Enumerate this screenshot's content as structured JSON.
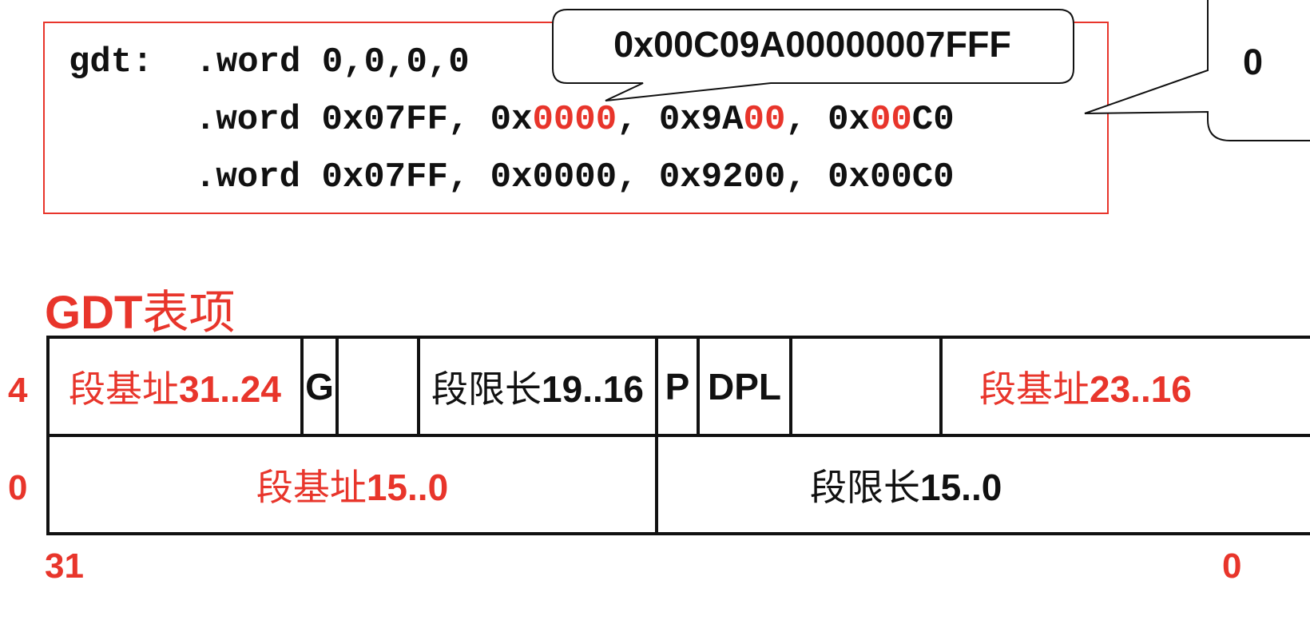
{
  "code": {
    "line1": {
      "label": "gdt:",
      "directive": ".word",
      "values": "0,0,0,0"
    },
    "line2": {
      "directive": ".word",
      "v1": "0x07FF, ",
      "v2_prefix": "0x",
      "v2_red": "0000",
      "sep2": ", ",
      "v3_prefix": "0x9A",
      "v3_red": "00",
      "sep3": ", ",
      "v4_prefix": "0x",
      "v4_red": "00",
      "v4_suffix": "C0"
    },
    "line3": {
      "directive": ".word",
      "values": "0x07FF, 0x0000, 0x9200, 0x00C0"
    }
  },
  "callouts": {
    "main": "0x00C09A00000007FFF",
    "partial": "0"
  },
  "section_title": {
    "latin": "GDT",
    "cjk": "表项"
  },
  "row_labels": {
    "top": "4",
    "bottom": "0"
  },
  "bit_labels": {
    "left": "31",
    "right": "0"
  },
  "table": {
    "row1": [
      {
        "cjk": "段基址",
        "num": "31..24",
        "red": true
      },
      {
        "cjk": "",
        "num": "G",
        "red": false
      },
      {
        "cjk": "",
        "num": "",
        "red": false
      },
      {
        "cjk": "段限长",
        "num": "19..16",
        "red": false
      },
      {
        "cjk": "",
        "num": "P",
        "red": false
      },
      {
        "cjk": "",
        "num": "DPL",
        "red": false
      },
      {
        "cjk": "",
        "num": "",
        "red": false
      },
      {
        "cjk": "段基址",
        "num": "23..16",
        "red": true
      }
    ],
    "row2": [
      {
        "cjk": "段基址",
        "num": "15..0",
        "red": true
      },
      {
        "cjk": "段限长",
        "num": "15..0",
        "red": false
      }
    ]
  },
  "colors": {
    "accent": "#e8352b",
    "text": "#111111"
  }
}
